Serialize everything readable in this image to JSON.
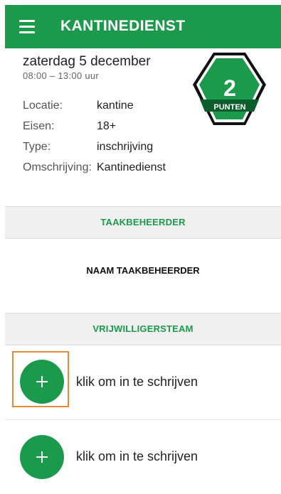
{
  "app_bar": {
    "title": "KANTINEDIENST",
    "menu_icon": "hamburger-menu-icon",
    "color": "#1b9a4c"
  },
  "task": {
    "date": "zaterdag 5 december",
    "time": "08:00 – 13:00 uur",
    "details": [
      {
        "label": "Locatie:",
        "value": "kantine"
      },
      {
        "label": "Eisen:",
        "value": "18+"
      },
      {
        "label": "Type:",
        "value": "inschrijving"
      },
      {
        "label": "Omschrijving:",
        "value": "Kantinedienst"
      }
    ]
  },
  "points_badge": {
    "value": "2",
    "label": "PUNTEN"
  },
  "manager_section": {
    "header": "TAAKBEHEERDER",
    "name": "NAAM TAAKBEHEERDER"
  },
  "volunteer_section": {
    "header": "VRIJWILLIGERSTEAM",
    "slots": [
      {
        "label": "klik om in te schrijven",
        "icon": "plus-icon"
      },
      {
        "label": "klik om in te schrijven",
        "icon": "plus-icon"
      }
    ]
  },
  "colors": {
    "accent": "#1b9a4c",
    "highlight": "#e8893a",
    "badge_dark": "#0d5c2c"
  }
}
